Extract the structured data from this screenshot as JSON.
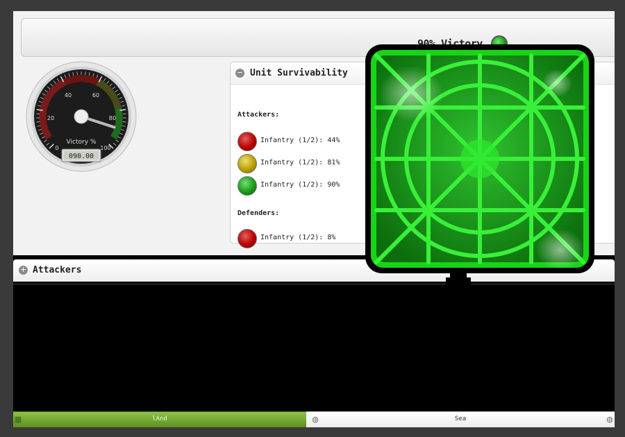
{
  "summary": {
    "victory_text": "90% Victory",
    "victory_status_color": "#139613"
  },
  "gauge": {
    "label": "Victory %",
    "ticks": [
      "0",
      "20",
      "40",
      "60",
      "80",
      "100"
    ],
    "value": 90,
    "readout": "090.00"
  },
  "survivability": {
    "title": "Unit Survivability",
    "collapse_icon": "minus-circle-icon",
    "attackers_label": "Attackers:",
    "attackers": [
      {
        "text": "Infantry (1/2): 44%",
        "status": "red"
      },
      {
        "text": "Infantry (1/2): 81%",
        "status": "yellow"
      },
      {
        "text": "Infantry (1/2): 90%",
        "status": "green"
      }
    ],
    "defenders_label": "Defenders:",
    "defenders": [
      {
        "text": "Infantry (1/2): 8%",
        "status": "red"
      }
    ]
  },
  "attackers_panel": {
    "title": "Attackers",
    "expand_icon": "plus-circle-icon"
  },
  "tabs": {
    "land": {
      "label": "lAnd",
      "icon": "land-icon",
      "active": true
    },
    "sea": {
      "label": "Sea",
      "icon": "globe-icon",
      "active": false
    }
  },
  "overlay": {
    "icon": "radar-screen-icon",
    "accent": "#27e827"
  }
}
